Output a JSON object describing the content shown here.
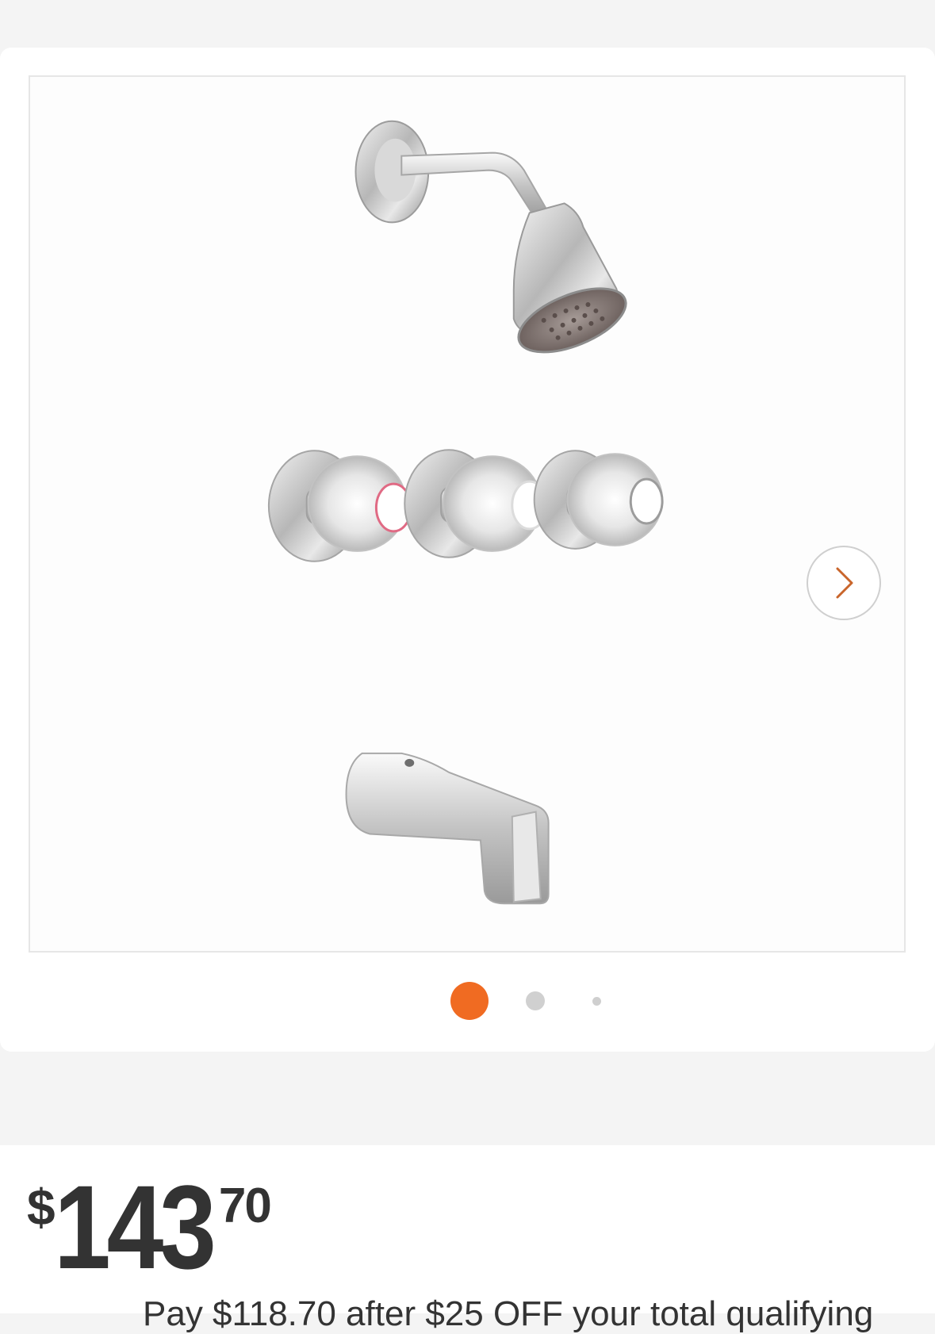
{
  "gallery": {
    "image_alt": "Moen three-handle tub and shower faucet in chrome: showerhead, three clear acrylic knob handles and tub spout",
    "next_button_label": "Next image",
    "colors": {
      "accent": "#f06b22",
      "dot_inactive": "#d0d0d0",
      "frame_border": "#e6e6e6",
      "chevron": "#c9652b"
    },
    "dots": [
      {
        "label": "Image 1",
        "active": true
      },
      {
        "label": "Image 2",
        "active": false
      },
      {
        "label": "Image 3",
        "active": false
      }
    ]
  },
  "price": {
    "currency": "$",
    "dollars": "143",
    "cents": "70"
  },
  "promo": {
    "text": "Pay $118.70 after $25 OFF your total qualifying"
  }
}
